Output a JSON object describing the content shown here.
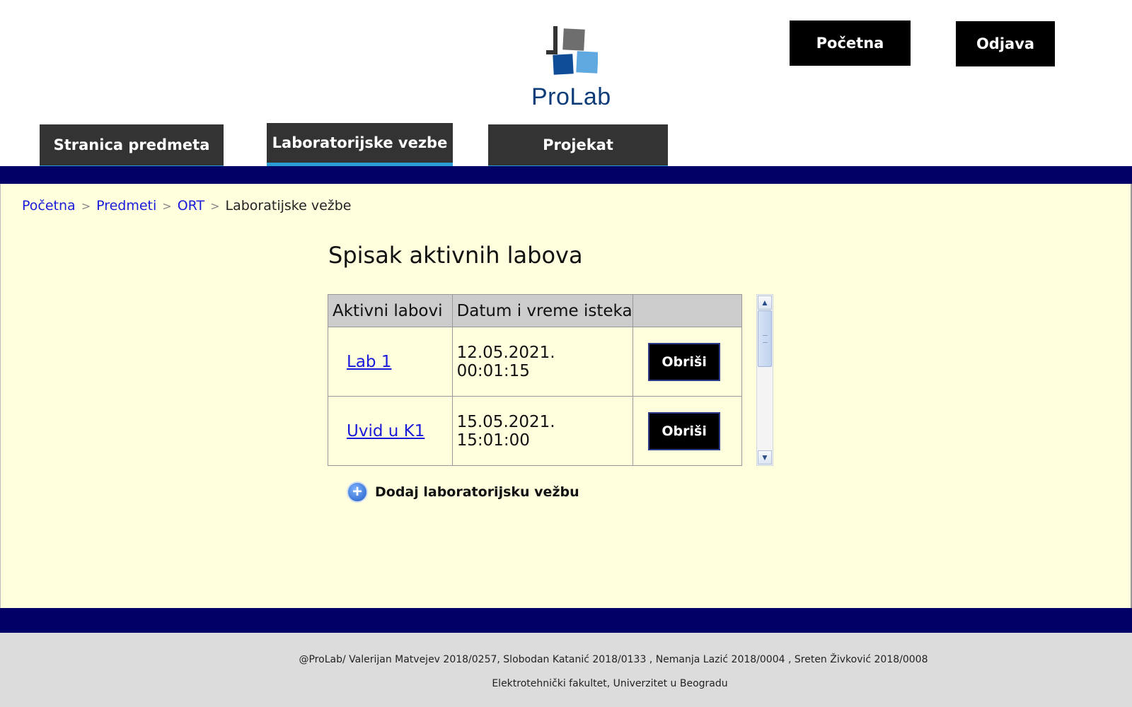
{
  "header": {
    "logo_text": "ProLab",
    "buttons": {
      "home": "Početna",
      "logout": "Odjava"
    },
    "tabs": [
      {
        "label": "Stranica predmeta"
      },
      {
        "label": "Laboratorijske vezbe",
        "active": true
      },
      {
        "label": "Projekat"
      }
    ]
  },
  "breadcrumb": {
    "items": [
      "Početna",
      "Predmeti",
      "ORT"
    ],
    "current": "Laboratijske vežbe",
    "separator": ">"
  },
  "main": {
    "title": "Spisak aktivnih labova",
    "table": {
      "headers": [
        "Aktivni labovi",
        "Datum i vreme isteka",
        ""
      ],
      "rows": [
        {
          "name": "Lab 1",
          "expires": "12.05.2021. 00:01:15",
          "action": "Obriši"
        },
        {
          "name": "Uvid u K1",
          "expires": "15.05.2021. 15:01:00",
          "action": "Obriši"
        }
      ]
    },
    "add_label": "Dodaj laboratorijsku vežbu"
  },
  "footer": {
    "line1": "@ProLab/ Valerijan Matvejev 2018/0257, Slobodan Katanić 2018/0133 , Nemanja Lazić 2018/0004 , Sreten Živković 2018/0008",
    "line2": "Elektrotehnički fakultet, Univerzitet u Beogradu"
  },
  "colors": {
    "nav_bar": "#000066",
    "content_bg": "#ffffdd",
    "tab_bg": "#333333",
    "tab_accent": "#2a9bd5",
    "link": "#1a1adb"
  },
  "icons": {
    "logo": "prolab-logo-icon",
    "add": "plus-circle-icon",
    "scroll_up": "chevron-up-icon",
    "scroll_down": "chevron-down-icon"
  }
}
